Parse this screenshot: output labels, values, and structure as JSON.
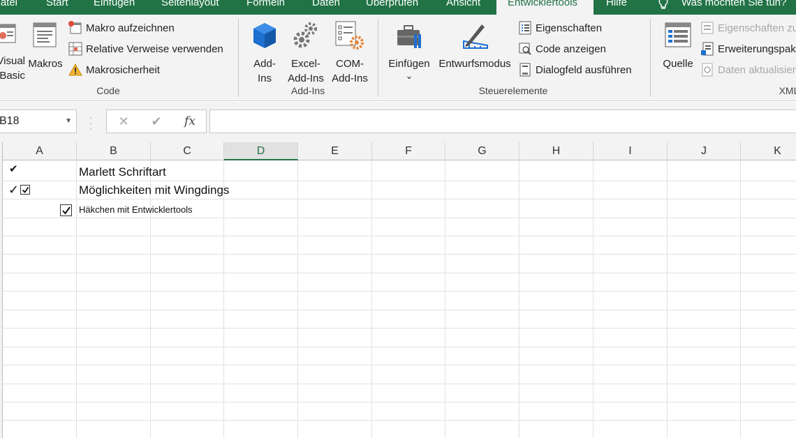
{
  "tabs": {
    "datei": "Datei",
    "start": "Start",
    "einfuegen": "Einfügen",
    "seitenlayout": "Seitenlayout",
    "formeln": "Formeln",
    "daten": "Daten",
    "ueberpruefen": "Überprüfen",
    "ansicht": "Ansicht",
    "entwicklertools": "Entwicklertools",
    "hilfe": "Hilfe",
    "tell_me": "Was möchten Sie tun?"
  },
  "ribbon": {
    "code": {
      "visual_basic_line1": "Visual",
      "visual_basic_line2": "Basic",
      "makros": "Makros",
      "makro_aufzeichnen": "Makro aufzeichnen",
      "relative_verweise": "Relative Verweise verwenden",
      "makrosicherheit": "Makrosicherheit",
      "group": "Code"
    },
    "addins": {
      "addins_line1": "Add-",
      "addins_line2": "Ins",
      "excel_line1": "Excel-",
      "excel_line2": "Add-Ins",
      "com_line1": "COM-",
      "com_line2": "Add-Ins",
      "group": "Add-Ins"
    },
    "steuerelemente": {
      "einfuegen": "Einfügen",
      "einfuegen_arrow": "⌄",
      "entwurfsmodus": "Entwurfsmodus",
      "eigenschaften": "Eigenschaften",
      "code_anzeigen": "Code anzeigen",
      "dialogfeld": "Dialogfeld ausführen",
      "group": "Steuerelemente"
    },
    "xml": {
      "quelle": "Quelle",
      "eigenschaften_zuordnen": "Eigenschaften zuordnen",
      "erweiterungspakete": "Erweiterungspakete",
      "daten_aktualisieren": "Daten aktualisieren",
      "group": "XML"
    }
  },
  "formula_bar": {
    "name_box": "B18",
    "cancel": "✕",
    "enter": "✔",
    "fx": "fx",
    "content": ""
  },
  "grid": {
    "columns": [
      "A",
      "B",
      "C",
      "D",
      "E",
      "F",
      "G",
      "H",
      "I",
      "J",
      "K"
    ],
    "selected_column": "D",
    "cells": {
      "a1_check": "✔",
      "b1": "Marlett Schriftart",
      "a2_check": "✓",
      "b2": "Möglichkeiten mit Wingdings",
      "b3": "Häkchen mit Entwicklertools"
    },
    "checkbox_a2_checked": true,
    "checkbox_a3_checked": true
  },
  "colors": {
    "accent": "#217346",
    "ribbon_bg": "#f3f3f3",
    "gridline": "#e1e1e1"
  }
}
